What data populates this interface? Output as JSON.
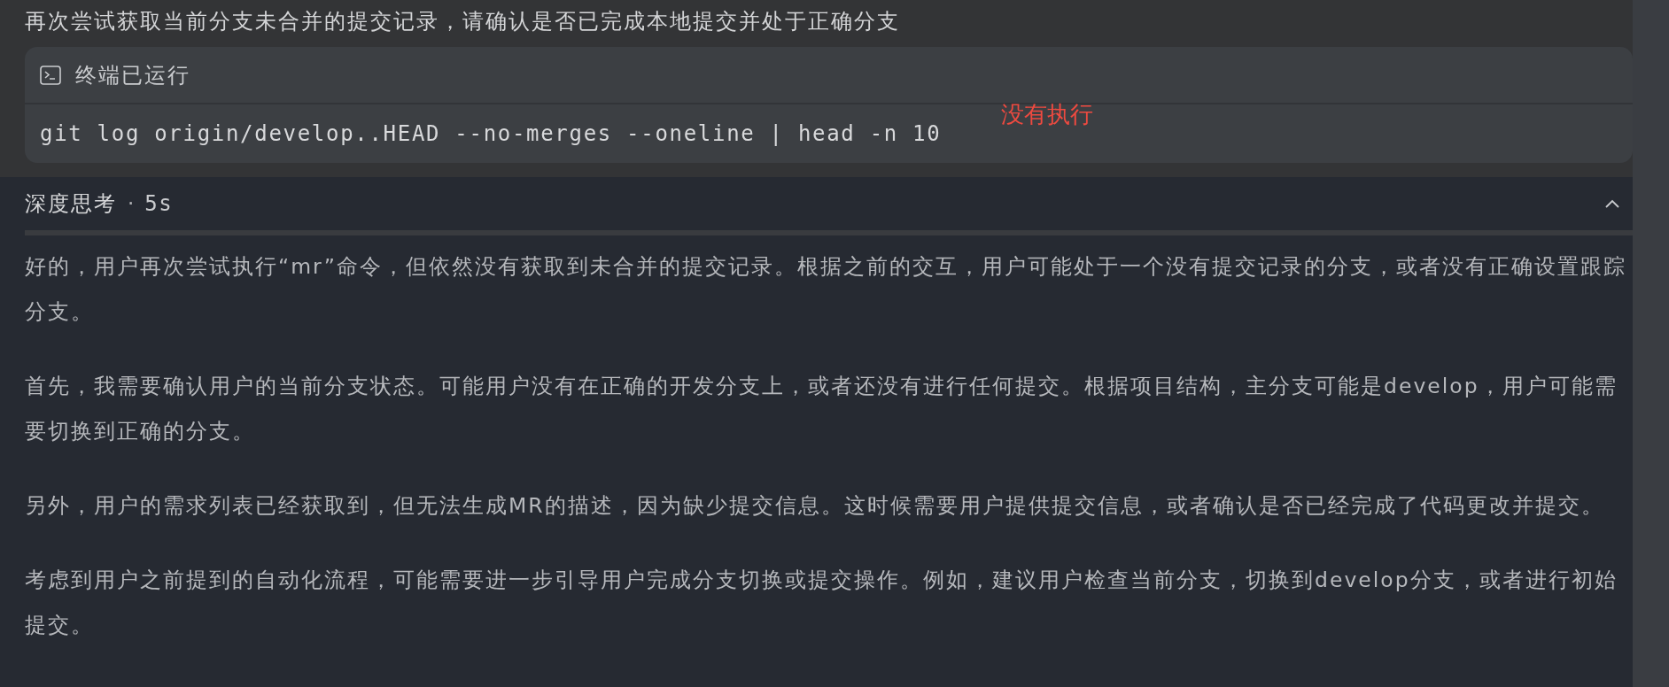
{
  "request": "再次尝试获取当前分支未合并的提交记录，请确认是否已完成本地提交并处于正确分支",
  "terminal": {
    "title": "终端已运行",
    "command": "git log origin/develop..HEAD --no-merges --oneline | head -n 10"
  },
  "annotation": "没有执行",
  "thinking": {
    "title": "深度思考",
    "separator": "·",
    "duration": "5s",
    "expanded": true,
    "paragraphs": [
      "好的，用户再次尝试执行“mr”命令，但依然没有获取到未合并的提交记录。根据之前的交互，用户可能处于一个没有提交记录的分支，或者没有正确设置跟踪分支。",
      "首先，我需要确认用户的当前分支状态。可能用户没有在正确的开发分支上，或者还没有进行任何提交。根据项目结构，主分支可能是develop，用户可能需要切换到正确的分支。",
      "另外，用户的需求列表已经获取到，但无法生成MR的描述，因为缺少提交信息。这时候需要用户提供提交信息，或者确认是否已经完成了代码更改并提交。",
      "考虑到用户之前提到的自动化流程，可能需要进一步引导用户完成分支切换或提交操作。例如，建议用户检查当前分支，切换到develop分支，或者进行初始提交。"
    ]
  }
}
